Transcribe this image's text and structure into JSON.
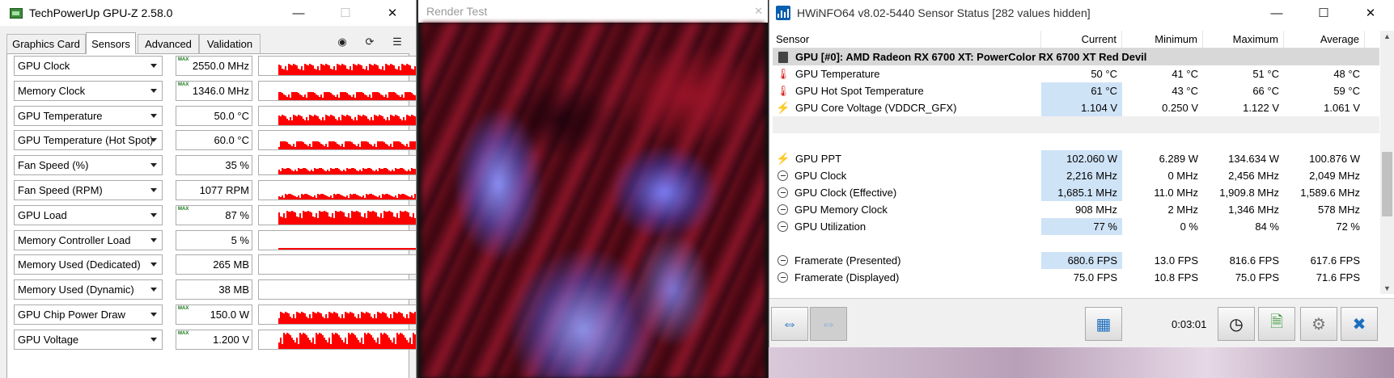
{
  "gpuz": {
    "title": "TechPowerUp GPU-Z 2.58.0",
    "tabs": [
      "Graphics Card",
      "Sensors",
      "Advanced",
      "Validation"
    ],
    "active_tab": "Sensors",
    "sensors": [
      {
        "name": "GPU Clock",
        "value": "2550.0 MHz",
        "max": "MAX",
        "fill": 0.6
      },
      {
        "name": "Memory Clock",
        "value": "1346.0 MHz",
        "max": "MAX",
        "fill": 0.45
      },
      {
        "name": "GPU Temperature",
        "value": "50.0 °C",
        "max": "",
        "fill": 0.55
      },
      {
        "name": "GPU Temperature (Hot Spot)",
        "value": "60.0 °C",
        "max": "",
        "fill": 0.45
      },
      {
        "name": "Fan Speed (%)",
        "value": "35 %",
        "max": "",
        "fill": 0.35
      },
      {
        "name": "Fan Speed (RPM)",
        "value": "1077 RPM",
        "max": "",
        "fill": 0.3
      },
      {
        "name": "GPU Load",
        "value": "87 %",
        "max": "MAX",
        "fill": 0.75
      },
      {
        "name": "Memory Controller Load",
        "value": "5 %",
        "max": "",
        "fill": 0.1
      },
      {
        "name": "Memory Used (Dedicated)",
        "value": "265 MB",
        "max": "",
        "fill": 0.0
      },
      {
        "name": "Memory Used (Dynamic)",
        "value": "38 MB",
        "max": "",
        "fill": 0.0
      },
      {
        "name": "GPU Chip Power Draw",
        "value": "150.0 W",
        "max": "MAX",
        "fill": 0.65
      },
      {
        "name": "GPU Voltage",
        "value": "1.200 V",
        "max": "MAX",
        "fill": 0.85
      }
    ]
  },
  "render": {
    "title": "Render Test",
    "close": "✕"
  },
  "hwinfo": {
    "title": "HWiNFO64 v8.02-5440 Sensor Status [282 values hidden]",
    "columns": [
      "Sensor",
      "Current",
      "Minimum",
      "Maximum",
      "Average"
    ],
    "group": "GPU [#0]: AMD Radeon RX 6700 XT: PowerColor RX 6700 XT Red Devil",
    "rows": [
      {
        "icon": "temp",
        "name": "GPU Temperature",
        "cur": "50 °C",
        "min": "41 °C",
        "max": "51 °C",
        "avg": "48 °C",
        "hl": false
      },
      {
        "icon": "temp",
        "name": "GPU Hot Spot Temperature",
        "cur": "61 °C",
        "min": "43 °C",
        "max": "66 °C",
        "avg": "59 °C",
        "hl": true
      },
      {
        "icon": "volt",
        "name": "GPU Core Voltage (VDDCR_GFX)",
        "cur": "1.104 V",
        "min": "0.250 V",
        "max": "1.122 V",
        "avg": "1.061 V",
        "hl": true
      },
      {
        "sep": true
      },
      {
        "blank": true
      },
      {
        "icon": "volt",
        "name": "GPU PPT",
        "cur": "102.060 W",
        "min": "6.289 W",
        "max": "134.634 W",
        "avg": "100.876 W",
        "hl": true
      },
      {
        "icon": "clock",
        "name": "GPU Clock",
        "cur": "2,216 MHz",
        "min": "0 MHz",
        "max": "2,456 MHz",
        "avg": "2,049 MHz",
        "hl": true
      },
      {
        "icon": "clock",
        "name": "GPU Clock (Effective)",
        "cur": "1,685.1 MHz",
        "min": "11.0 MHz",
        "max": "1,909.8 MHz",
        "avg": "1,589.6 MHz",
        "hl": true
      },
      {
        "icon": "clock",
        "name": "GPU Memory Clock",
        "cur": "908 MHz",
        "min": "2 MHz",
        "max": "1,346 MHz",
        "avg": "578 MHz",
        "hl": false
      },
      {
        "icon": "clock",
        "name": "GPU Utilization",
        "cur": "77 %",
        "min": "0 %",
        "max": "84 %",
        "avg": "72 %",
        "hl": true
      },
      {
        "blank": true
      },
      {
        "icon": "clock",
        "name": "Framerate (Presented)",
        "cur": "680.6 FPS",
        "min": "13.0 FPS",
        "max": "816.6 FPS",
        "avg": "617.6 FPS",
        "hl": true
      },
      {
        "icon": "clock",
        "name": "Framerate (Displayed)",
        "cur": "75.0 FPS",
        "min": "10.8 FPS",
        "max": "75.0 FPS",
        "avg": "71.6 FPS",
        "hl": false
      }
    ],
    "elapsed": "0:03:01"
  },
  "colors": {
    "graph": "#ff0000",
    "highlight": "#cfe3f7",
    "group": "#d8d8d8"
  }
}
